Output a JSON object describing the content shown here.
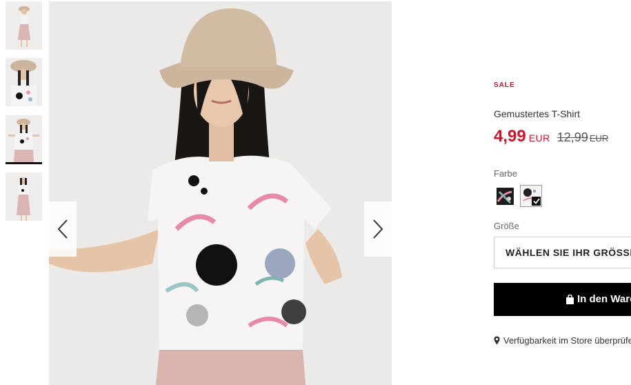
{
  "gallery": {
    "thumbnails": [
      {
        "alt": "thumbnail-1"
      },
      {
        "alt": "thumbnail-2"
      },
      {
        "alt": "thumbnail-3",
        "active": true
      },
      {
        "alt": "thumbnail-4"
      }
    ],
    "prev_icon": "chevron-left-icon",
    "next_icon": "chevron-right-icon"
  },
  "product": {
    "badge": "SALE",
    "title": "Gemustertes T-Shirt",
    "price_new": "4,99",
    "currency_new": "EUR",
    "price_old": "12,99",
    "currency_old": "EUR",
    "color_label": "Farbe",
    "size_label": "Größe",
    "size_select": "WÄHLEN SIE IHR GRÖSSE",
    "add_to_cart": "In den Warenkorb",
    "store_availability": "Verfügbarkeit im Store überprüfen"
  },
  "colors": {
    "sale": "#d0142c",
    "button_bg": "#000000"
  }
}
